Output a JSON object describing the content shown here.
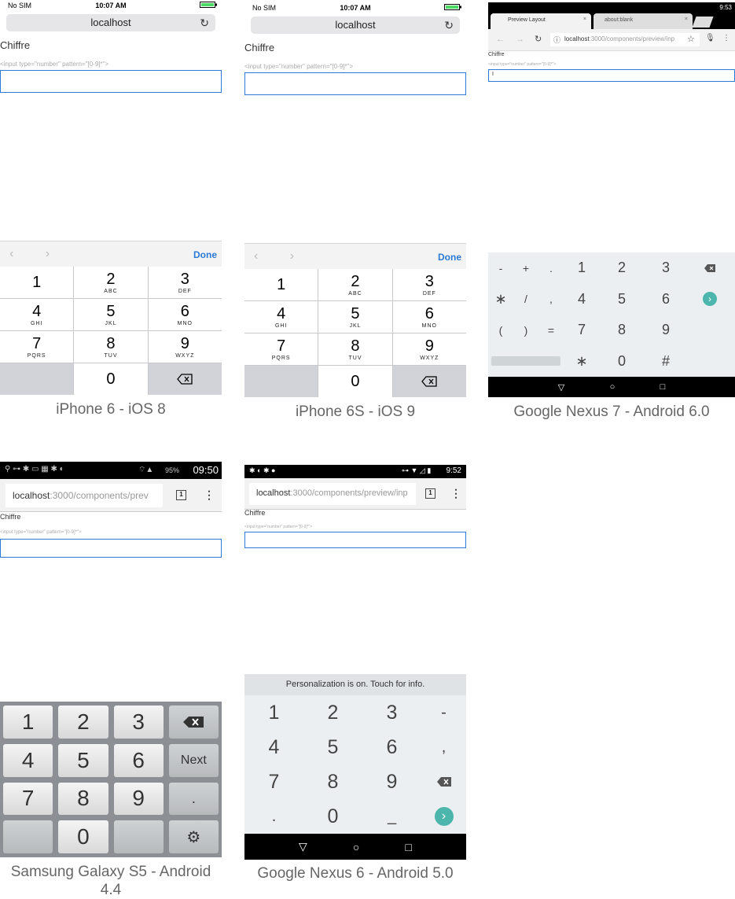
{
  "page_label": "Chiffre",
  "input_code": "<input type=\"number\" pattern=\"[0-9]*\">",
  "devices": {
    "iphone6": {
      "caption": "iPhone 6 - iOS 8",
      "carrier": "No SIM",
      "time": "10:07 AM",
      "url": "localhost",
      "done": "Done",
      "keys": [
        {
          "n": "1",
          "s": ""
        },
        {
          "n": "2",
          "s": "ABC"
        },
        {
          "n": "3",
          "s": "DEF"
        },
        {
          "n": "4",
          "s": "GHI"
        },
        {
          "n": "5",
          "s": "JKL"
        },
        {
          "n": "6",
          "s": "MNO"
        },
        {
          "n": "7",
          "s": "PQRS"
        },
        {
          "n": "8",
          "s": "TUV"
        },
        {
          "n": "9",
          "s": "WXYZ"
        },
        {
          "n": "",
          "s": ""
        },
        {
          "n": "0",
          "s": ""
        },
        {
          "n": "⌫",
          "s": ""
        }
      ]
    },
    "iphone6s": {
      "caption": "iPhone 6S - iOS 9",
      "carrier": "No SIM",
      "time": "10:07 AM",
      "url": "localhost",
      "done": "Done"
    },
    "nexus7": {
      "caption": "Google Nexus 7 - Android 6.0",
      "time": "9:53",
      "tab1": "Preview Layout",
      "tab2": "about:blank",
      "url_host": "localhost",
      "url_path": ":3000/components/preview/inp",
      "field_value": "I",
      "keys": [
        "-",
        "+",
        ".",
        "1",
        "2",
        "3",
        "⌫",
        "∗",
        "/",
        ",",
        "4",
        "5",
        "6",
        "›",
        "(",
        ")",
        "=",
        "7",
        "8",
        "9",
        "",
        "",
        "",
        "",
        "∗",
        "0",
        "#",
        ""
      ]
    },
    "galaxy_s5": {
      "caption": "Samsung Galaxy S5 - Android 4.4",
      "battery": "95%",
      "time": "09:50",
      "url_host": "localhost",
      "url_path": ":3000/components/prev",
      "tab_count": "1",
      "keys": [
        "1",
        "2",
        "3",
        "⌫",
        "4",
        "5",
        "6",
        "Next",
        "7",
        "8",
        "9",
        ".",
        "",
        "0",
        "",
        "⚙"
      ]
    },
    "nexus6": {
      "caption": "Google Nexus 6 - Android 5.0",
      "time": "9:52",
      "url_host": "localhost",
      "url_path": ":3000/components/preview/inp",
      "tab_count": "1",
      "personalization": "Personalization is on. Touch for info.",
      "keys": [
        "1",
        "2",
        "3",
        "-",
        "4",
        "5",
        "6",
        ",",
        "7",
        "8",
        "9",
        "⌫",
        ".",
        "0",
        "_",
        "›"
      ]
    }
  }
}
